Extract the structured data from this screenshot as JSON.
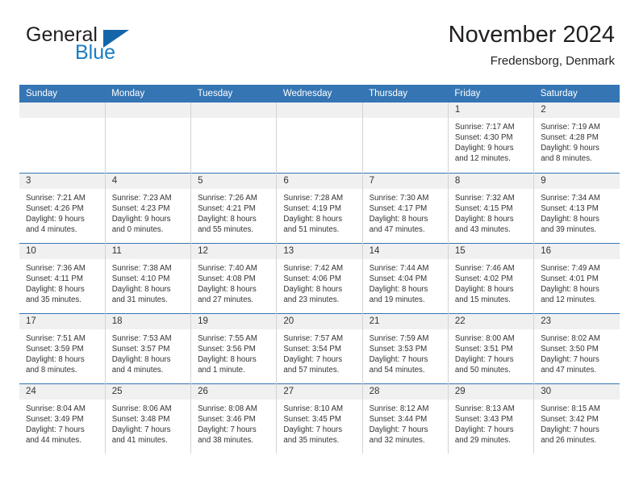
{
  "brand": {
    "name_part1": "General",
    "name_part2": "Blue",
    "logo_icon": "triangle-flag-icon"
  },
  "header": {
    "title": "November 2024",
    "subtitle": "Fredensborg, Denmark"
  },
  "colors": {
    "header_blue": "#3575b4",
    "brand_blue": "#1a7cc2",
    "daynum_band": "#f0f0f0",
    "cell_divider": "#d3d3d3",
    "text": "#333333"
  },
  "weekday_headers": [
    "Sunday",
    "Monday",
    "Tuesday",
    "Wednesday",
    "Thursday",
    "Friday",
    "Saturday"
  ],
  "weeks": [
    [
      {
        "empty": true
      },
      {
        "empty": true
      },
      {
        "empty": true
      },
      {
        "empty": true
      },
      {
        "empty": true
      },
      {
        "day": "1",
        "sunrise": "Sunrise: 7:17 AM",
        "sunset": "Sunset: 4:30 PM",
        "daylight_line1": "Daylight: 9 hours",
        "daylight_line2": "and 12 minutes."
      },
      {
        "day": "2",
        "sunrise": "Sunrise: 7:19 AM",
        "sunset": "Sunset: 4:28 PM",
        "daylight_line1": "Daylight: 9 hours",
        "daylight_line2": "and 8 minutes."
      }
    ],
    [
      {
        "day": "3",
        "sunrise": "Sunrise: 7:21 AM",
        "sunset": "Sunset: 4:26 PM",
        "daylight_line1": "Daylight: 9 hours",
        "daylight_line2": "and 4 minutes."
      },
      {
        "day": "4",
        "sunrise": "Sunrise: 7:23 AM",
        "sunset": "Sunset: 4:23 PM",
        "daylight_line1": "Daylight: 9 hours",
        "daylight_line2": "and 0 minutes."
      },
      {
        "day": "5",
        "sunrise": "Sunrise: 7:26 AM",
        "sunset": "Sunset: 4:21 PM",
        "daylight_line1": "Daylight: 8 hours",
        "daylight_line2": "and 55 minutes."
      },
      {
        "day": "6",
        "sunrise": "Sunrise: 7:28 AM",
        "sunset": "Sunset: 4:19 PM",
        "daylight_line1": "Daylight: 8 hours",
        "daylight_line2": "and 51 minutes."
      },
      {
        "day": "7",
        "sunrise": "Sunrise: 7:30 AM",
        "sunset": "Sunset: 4:17 PM",
        "daylight_line1": "Daylight: 8 hours",
        "daylight_line2": "and 47 minutes."
      },
      {
        "day": "8",
        "sunrise": "Sunrise: 7:32 AM",
        "sunset": "Sunset: 4:15 PM",
        "daylight_line1": "Daylight: 8 hours",
        "daylight_line2": "and 43 minutes."
      },
      {
        "day": "9",
        "sunrise": "Sunrise: 7:34 AM",
        "sunset": "Sunset: 4:13 PM",
        "daylight_line1": "Daylight: 8 hours",
        "daylight_line2": "and 39 minutes."
      }
    ],
    [
      {
        "day": "10",
        "sunrise": "Sunrise: 7:36 AM",
        "sunset": "Sunset: 4:11 PM",
        "daylight_line1": "Daylight: 8 hours",
        "daylight_line2": "and 35 minutes."
      },
      {
        "day": "11",
        "sunrise": "Sunrise: 7:38 AM",
        "sunset": "Sunset: 4:10 PM",
        "daylight_line1": "Daylight: 8 hours",
        "daylight_line2": "and 31 minutes."
      },
      {
        "day": "12",
        "sunrise": "Sunrise: 7:40 AM",
        "sunset": "Sunset: 4:08 PM",
        "daylight_line1": "Daylight: 8 hours",
        "daylight_line2": "and 27 minutes."
      },
      {
        "day": "13",
        "sunrise": "Sunrise: 7:42 AM",
        "sunset": "Sunset: 4:06 PM",
        "daylight_line1": "Daylight: 8 hours",
        "daylight_line2": "and 23 minutes."
      },
      {
        "day": "14",
        "sunrise": "Sunrise: 7:44 AM",
        "sunset": "Sunset: 4:04 PM",
        "daylight_line1": "Daylight: 8 hours",
        "daylight_line2": "and 19 minutes."
      },
      {
        "day": "15",
        "sunrise": "Sunrise: 7:46 AM",
        "sunset": "Sunset: 4:02 PM",
        "daylight_line1": "Daylight: 8 hours",
        "daylight_line2": "and 15 minutes."
      },
      {
        "day": "16",
        "sunrise": "Sunrise: 7:49 AM",
        "sunset": "Sunset: 4:01 PM",
        "daylight_line1": "Daylight: 8 hours",
        "daylight_line2": "and 12 minutes."
      }
    ],
    [
      {
        "day": "17",
        "sunrise": "Sunrise: 7:51 AM",
        "sunset": "Sunset: 3:59 PM",
        "daylight_line1": "Daylight: 8 hours",
        "daylight_line2": "and 8 minutes."
      },
      {
        "day": "18",
        "sunrise": "Sunrise: 7:53 AM",
        "sunset": "Sunset: 3:57 PM",
        "daylight_line1": "Daylight: 8 hours",
        "daylight_line2": "and 4 minutes."
      },
      {
        "day": "19",
        "sunrise": "Sunrise: 7:55 AM",
        "sunset": "Sunset: 3:56 PM",
        "daylight_line1": "Daylight: 8 hours",
        "daylight_line2": "and 1 minute."
      },
      {
        "day": "20",
        "sunrise": "Sunrise: 7:57 AM",
        "sunset": "Sunset: 3:54 PM",
        "daylight_line1": "Daylight: 7 hours",
        "daylight_line2": "and 57 minutes."
      },
      {
        "day": "21",
        "sunrise": "Sunrise: 7:59 AM",
        "sunset": "Sunset: 3:53 PM",
        "daylight_line1": "Daylight: 7 hours",
        "daylight_line2": "and 54 minutes."
      },
      {
        "day": "22",
        "sunrise": "Sunrise: 8:00 AM",
        "sunset": "Sunset: 3:51 PM",
        "daylight_line1": "Daylight: 7 hours",
        "daylight_line2": "and 50 minutes."
      },
      {
        "day": "23",
        "sunrise": "Sunrise: 8:02 AM",
        "sunset": "Sunset: 3:50 PM",
        "daylight_line1": "Daylight: 7 hours",
        "daylight_line2": "and 47 minutes."
      }
    ],
    [
      {
        "day": "24",
        "sunrise": "Sunrise: 8:04 AM",
        "sunset": "Sunset: 3:49 PM",
        "daylight_line1": "Daylight: 7 hours",
        "daylight_line2": "and 44 minutes."
      },
      {
        "day": "25",
        "sunrise": "Sunrise: 8:06 AM",
        "sunset": "Sunset: 3:48 PM",
        "daylight_line1": "Daylight: 7 hours",
        "daylight_line2": "and 41 minutes."
      },
      {
        "day": "26",
        "sunrise": "Sunrise: 8:08 AM",
        "sunset": "Sunset: 3:46 PM",
        "daylight_line1": "Daylight: 7 hours",
        "daylight_line2": "and 38 minutes."
      },
      {
        "day": "27",
        "sunrise": "Sunrise: 8:10 AM",
        "sunset": "Sunset: 3:45 PM",
        "daylight_line1": "Daylight: 7 hours",
        "daylight_line2": "and 35 minutes."
      },
      {
        "day": "28",
        "sunrise": "Sunrise: 8:12 AM",
        "sunset": "Sunset: 3:44 PM",
        "daylight_line1": "Daylight: 7 hours",
        "daylight_line2": "and 32 minutes."
      },
      {
        "day": "29",
        "sunrise": "Sunrise: 8:13 AM",
        "sunset": "Sunset: 3:43 PM",
        "daylight_line1": "Daylight: 7 hours",
        "daylight_line2": "and 29 minutes."
      },
      {
        "day": "30",
        "sunrise": "Sunrise: 8:15 AM",
        "sunset": "Sunset: 3:42 PM",
        "daylight_line1": "Daylight: 7 hours",
        "daylight_line2": "and 26 minutes."
      }
    ]
  ]
}
